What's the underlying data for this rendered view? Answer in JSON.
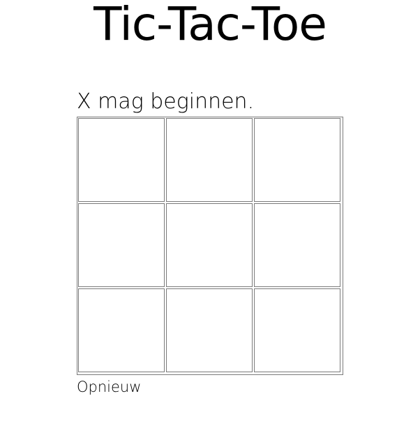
{
  "page": {
    "title": "Tic-Tac-Toe",
    "status": "X mag beginnen."
  },
  "board": {
    "cells": [
      "",
      "",
      "",
      "",
      "",
      "",
      "",
      "",
      ""
    ]
  },
  "controls": {
    "reset_label": "Opnieuw"
  },
  "colors": {
    "text": "#000000",
    "grid_line": "#7a7a7a",
    "background": "#ffffff"
  }
}
